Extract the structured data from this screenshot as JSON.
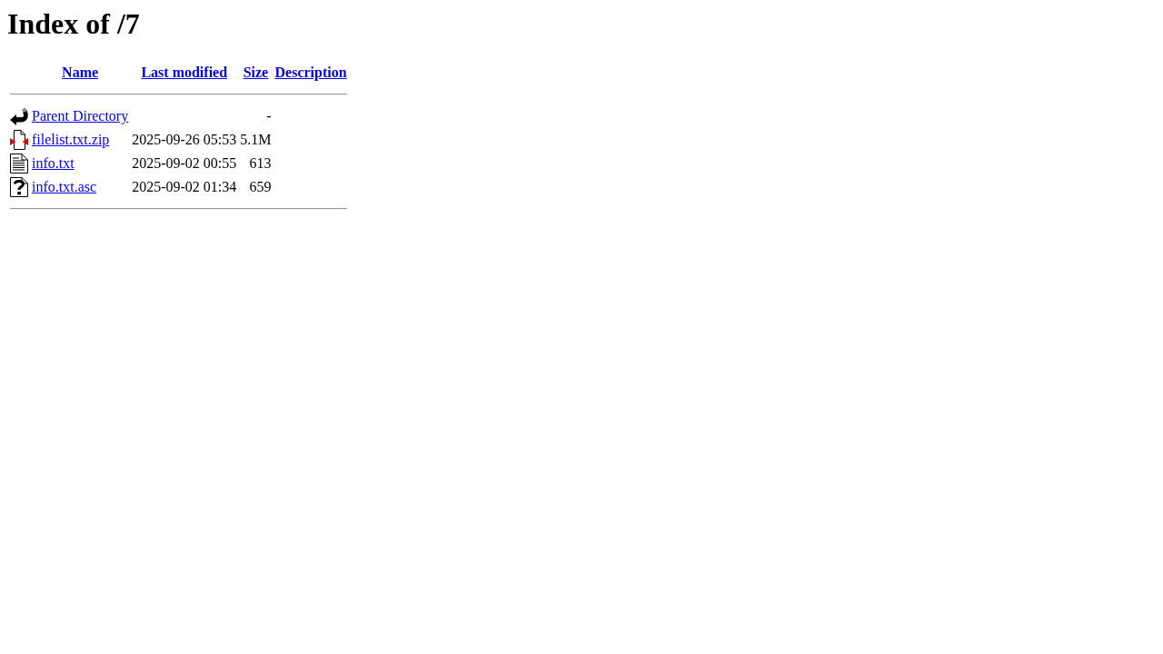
{
  "title": "Index of /7",
  "table": {
    "columns": [
      "Name",
      "Last modified",
      "Size",
      "Description"
    ],
    "rows": [
      {
        "kind": "parent",
        "name": "Parent Directory",
        "size": "-"
      },
      {
        "kind": "compressed",
        "name": "filelist.txt.zip",
        "last_modified": "2025-09-26 05:53",
        "size": "5.1M"
      },
      {
        "kind": "text",
        "name": "info.txt",
        "last_modified": "2025-09-02 00:55",
        "size": "613"
      },
      {
        "kind": "unknown",
        "name": "info.txt.asc",
        "last_modified": "2025-09-02 01:34",
        "size": "659"
      }
    ]
  }
}
